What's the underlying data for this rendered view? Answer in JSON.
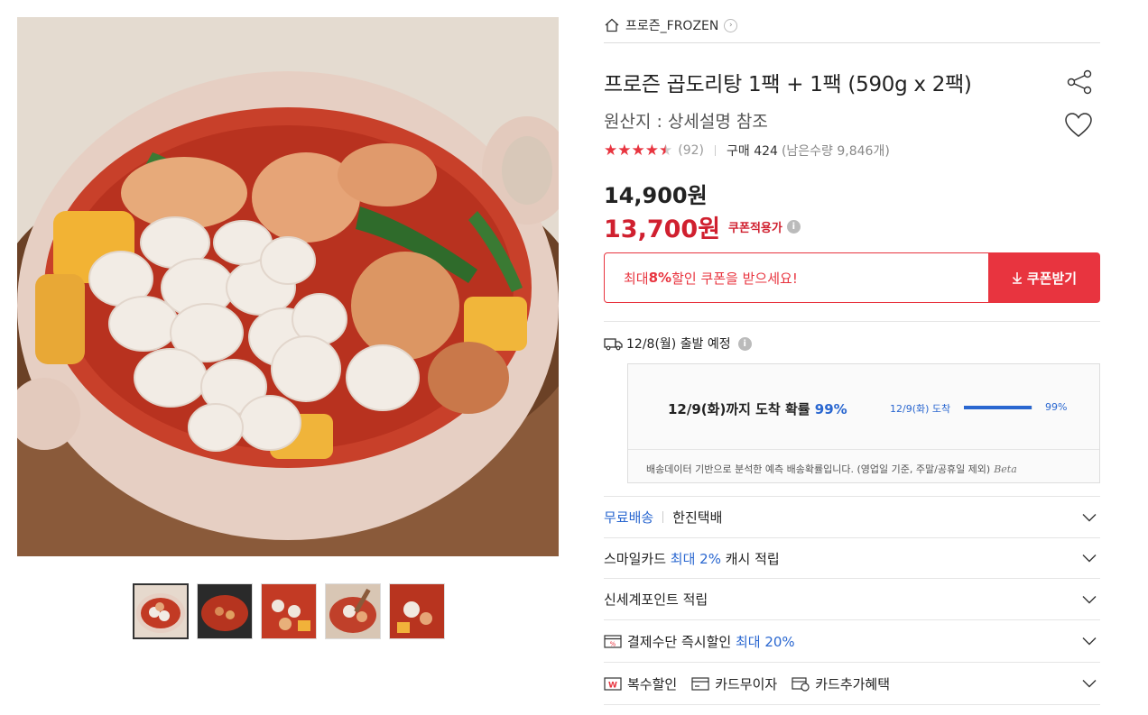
{
  "breadcrumb": {
    "label": "프로즌_FROZEN"
  },
  "product": {
    "title": "프로즌 곱도리탕 1팩 + 1팩 (590g x 2팩)",
    "origin": "원산지 : 상세설명 참조",
    "rating": 4.5,
    "review_count": "(92)",
    "purchase": "구매 424",
    "remaining": "(남은수량 9,846개)",
    "price_original": "14,900원",
    "price_sale": "13,700원",
    "coupon_price_label": "쿠폰적용가",
    "info_glyph": "i"
  },
  "coupon": {
    "text_prefix": "최대 ",
    "text_pct": "8%",
    "text_suffix": " 할인 쿠폰을 받으세요!",
    "button_label": "쿠폰받기"
  },
  "shipping": {
    "departure": "12/8(월) 출발 예정",
    "prob_main": "12/9(화)까지 도착 확률 ",
    "prob_pct": "99%",
    "prob_small_label": "12/9(화) 도착",
    "prob_small_pct": "99%",
    "prob_fraction": 0.99,
    "note": "배송데이터 기반으로 분석한 예측 배송확률입니다. (영업일 기준, 주말/공휴일 제외)",
    "beta": "Beta"
  },
  "accordion": {
    "free_shipping": "무료배송",
    "courier": "한진택배",
    "smilecard_prefix": "스마일카드 ",
    "smilecard_highlight": "최대 2%",
    "smilecard_suffix": " 캐시 적립",
    "ssg_point": "신세계포인트 적립",
    "payment_prefix": "결제수단 즉시할인 ",
    "payment_highlight": "최대 20%",
    "multi_discount": "복수할인",
    "card_interest_free": "카드무이자",
    "card_extra": "카드추가혜택"
  },
  "colors": {
    "accent_red": "#e8343f",
    "sale_red": "#d0202f",
    "link_blue": "#2a67d0"
  }
}
